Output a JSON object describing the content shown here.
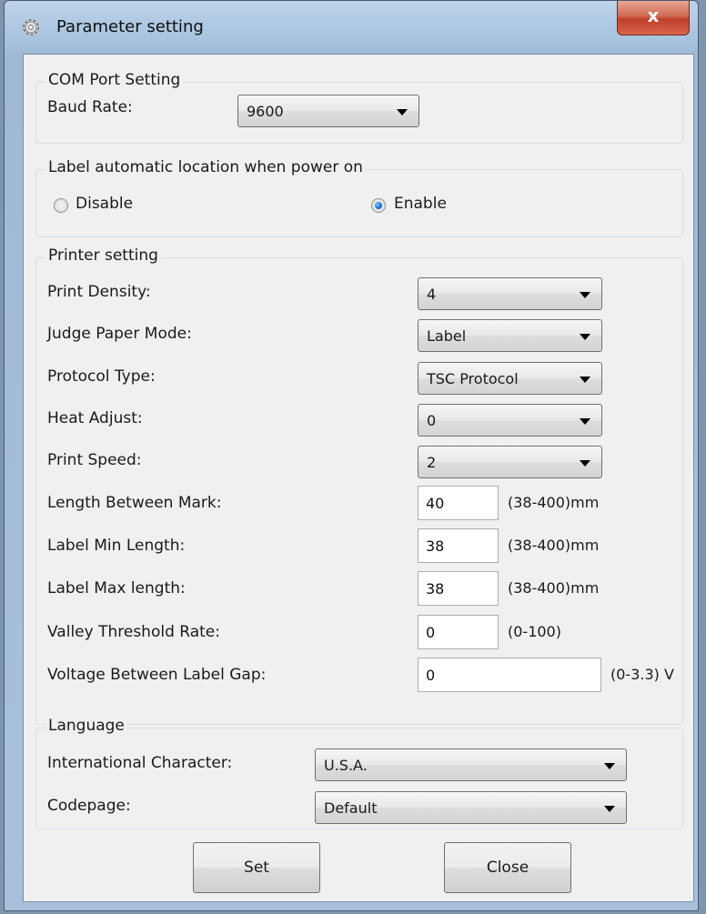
{
  "window": {
    "title": "Parameter setting",
    "close_label": "x"
  },
  "com_port": {
    "legend": "COM Port Setting",
    "baud_rate_label": "Baud Rate:",
    "baud_rate_value": "9600"
  },
  "auto_location": {
    "legend": "Label automatic location when power on",
    "disable_label": "Disable",
    "enable_label": "Enable",
    "selected": "Enable"
  },
  "printer": {
    "legend": "Printer setting",
    "print_density": {
      "label": "Print Density:",
      "value": "4"
    },
    "judge_paper_mode": {
      "label": "Judge Paper Mode:",
      "value": "Label"
    },
    "protocol_type": {
      "label": "Protocol Type:",
      "value": "TSC Protocol"
    },
    "heat_adjust": {
      "label": "Heat Adjust:",
      "value": "0"
    },
    "print_speed": {
      "label": "Print Speed:",
      "value": "2"
    },
    "length_between_mark": {
      "label": "Length Between Mark:",
      "value": "40",
      "range": "(38-400)mm"
    },
    "label_min_length": {
      "label": "Label Min Length:",
      "value": "38",
      "range": "(38-400)mm"
    },
    "label_max_length": {
      "label": "Label Max length:",
      "value": "38",
      "range": "(38-400)mm"
    },
    "valley_threshold_rate": {
      "label": "Valley Threshold Rate:",
      "value": "0",
      "range": "(0-100)"
    },
    "voltage_between_label_gap": {
      "label": "Voltage Between Label Gap:",
      "value": "0",
      "range": "(0-3.3) V"
    }
  },
  "language": {
    "legend": "Language",
    "international_character": {
      "label": "International Character:",
      "value": "U.S.A."
    },
    "codepage": {
      "label": "Codepage:",
      "value": "Default"
    }
  },
  "buttons": {
    "set_label": "Set",
    "close_label": "Close"
  }
}
